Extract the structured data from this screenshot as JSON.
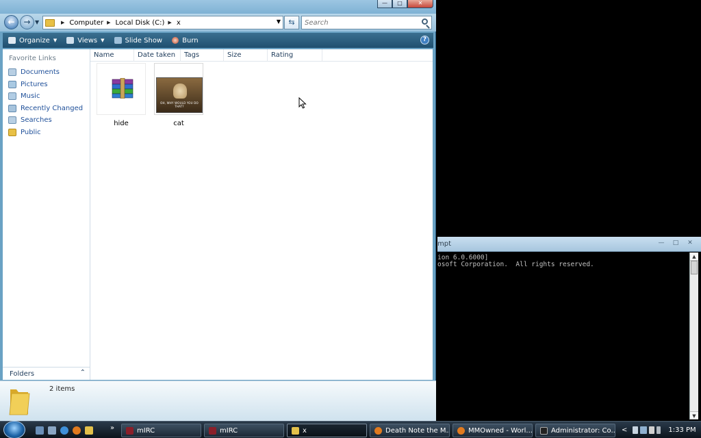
{
  "explorer": {
    "breadcrumb": [
      "Computer",
      "Local Disk (C:)",
      "x"
    ],
    "search_placeholder": "Search",
    "toolbar": {
      "organize": "Organize",
      "views": "Views",
      "slideshow": "Slide Show",
      "burn": "Burn"
    },
    "nav": {
      "heading": "Favorite Links",
      "items": [
        "Documents",
        "Pictures",
        "Music",
        "Recently Changed",
        "Searches",
        "Public"
      ],
      "folders_label": "Folders"
    },
    "columns": [
      "Name",
      "Date taken",
      "Tags",
      "Size",
      "Rating"
    ],
    "files": [
      {
        "name": "hide",
        "icon": "winrar-archive-icon"
      },
      {
        "name": "cat",
        "icon": "image-thumbnail",
        "caption": "OH, WHY WOULD YOU DO THAT?"
      }
    ],
    "details": {
      "count": "2 items"
    }
  },
  "cmd": {
    "title": "mpt",
    "lines": [
      "ion 6.0.6000]",
      "osoft Corporation.  All rights reserved."
    ]
  },
  "taskbar": {
    "more": "»",
    "buttons": [
      {
        "label": "mIRC",
        "color": "#8a1f2a"
      },
      {
        "label": "mIRC",
        "color": "#8a1f2a"
      },
      {
        "label": "x",
        "color": "#e3c04a"
      },
      {
        "label": "Death Note the M...",
        "color": "#e07a1f"
      },
      {
        "label": "MMOwned - Worl...",
        "color": "#e07a1f"
      },
      {
        "label": "Administrator: Co...",
        "color": "#222222"
      }
    ],
    "tray_chevron": "<",
    "clock": "1:33 PM"
  },
  "colors": {
    "explorer_chrome": "#6aa2c4",
    "toolbar": "#2a5d7e",
    "link": "#1e4f99",
    "console_bg": "#000000",
    "console_text": "#c0c0c0"
  }
}
